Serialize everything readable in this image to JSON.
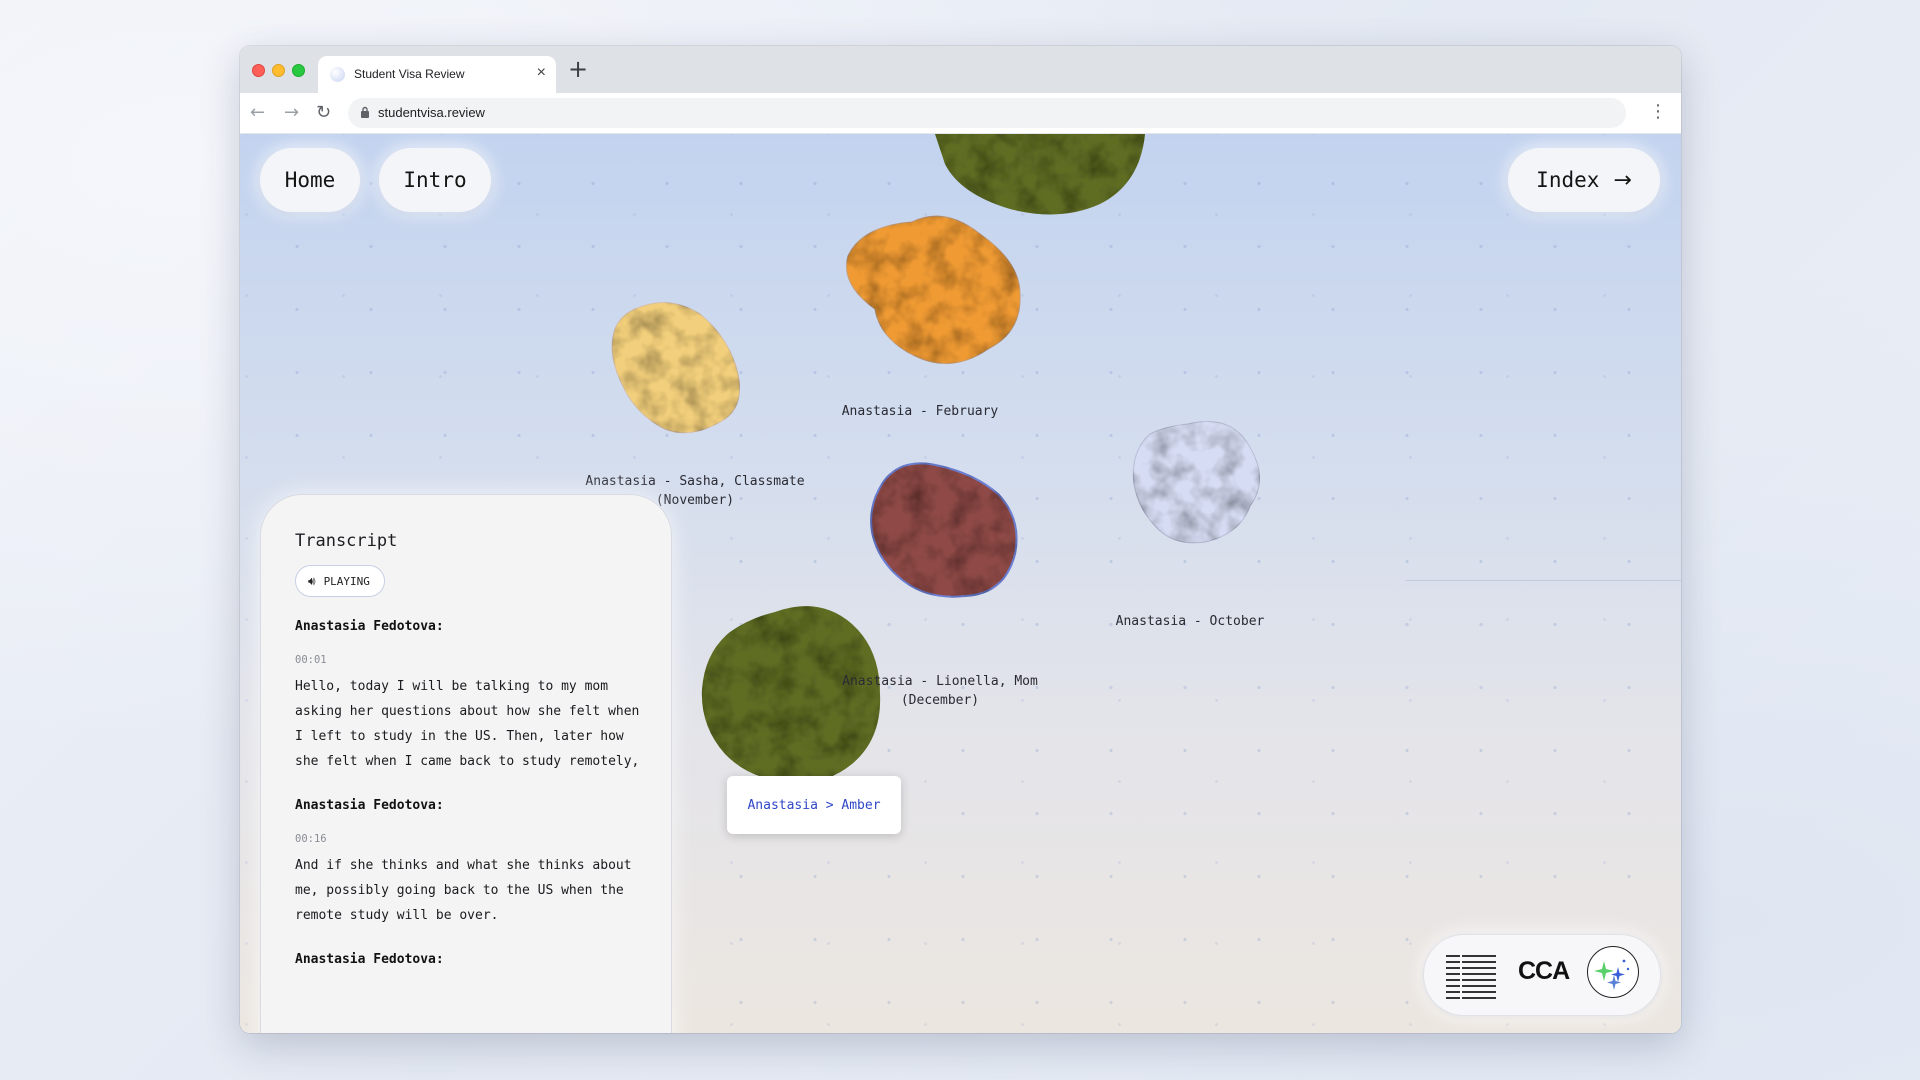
{
  "browser": {
    "tab_title": "Student Visa Review",
    "tab_close": "×",
    "new_tab": "+",
    "url": "studentvisa.review",
    "back_icon": "←",
    "forward_icon": "→",
    "reload_icon": "↻",
    "menu_icon": "⋮"
  },
  "nav": {
    "home": "Home",
    "intro": "Intro",
    "index": "Index",
    "index_arrow": "→"
  },
  "blobs": [
    {
      "label": "Anastasia - February",
      "color": "#ef9a33"
    },
    {
      "label_line1": "Anastasia - Sasha, Classmate",
      "label_line2": "(November)",
      "color": "#f2cf7b"
    },
    {
      "label": "Anastasia - October",
      "color": "#d6dcf3"
    },
    {
      "label_line1": "Anastasia - Lionella, Mom",
      "label_line2": "(December)",
      "color": "#8f4a47"
    },
    {
      "label": "",
      "color": "#5f6d23"
    }
  ],
  "tag": {
    "text": "Anastasia > Amber"
  },
  "transcript": {
    "title": "Transcript",
    "status": "PLAYING",
    "entries": [
      {
        "speaker": "Anastasia Fedotova:",
        "time": "00:01",
        "text": "Hello, today I will be talking to my mom asking her questions about how she felt when I left to study in the US. Then, later how she felt when I came back to study remotely,"
      },
      {
        "speaker": "Anastasia Fedotova:",
        "time": "00:16",
        "text": "And if she thinks and what she thinks about me, possibly going back to the US when the remote study will be over."
      },
      {
        "speaker": "Anastasia Fedotova:"
      }
    ]
  },
  "sponsors": {
    "cca": "CCA"
  },
  "colors": {
    "accent_link": "#2f47c8",
    "panel_bg": "#f4f4f5"
  }
}
